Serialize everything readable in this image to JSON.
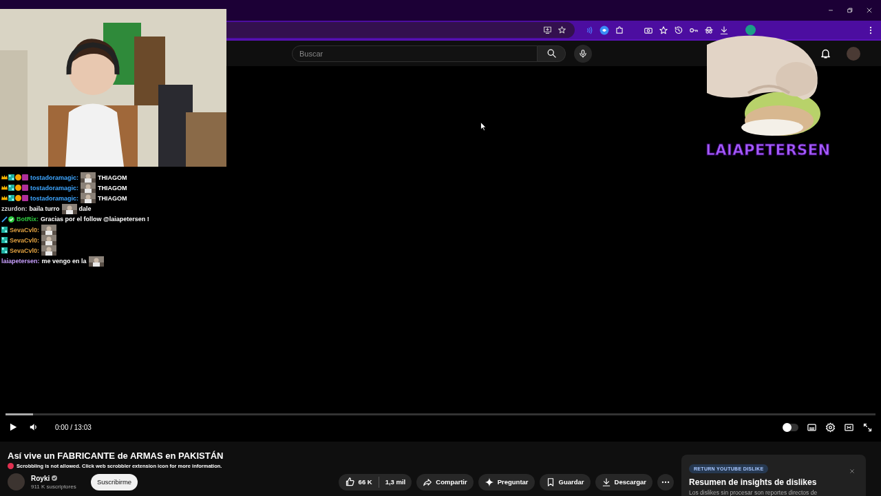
{
  "masthead": {
    "search": {
      "placeholder": "Buscar"
    }
  },
  "player": {
    "progress": {
      "level": 0
    },
    "time": "0:00 / 13:03",
    "autoplay": {
      "on": false
    }
  },
  "video": {
    "title": "Así vive un FABRICANTE de ARMAS en PAKISTÁN",
    "scrobble_note": "Scrobbling is not allowed. Click web scrobbler extension icon for more information.",
    "channel": {
      "name": "Royki",
      "verified": true,
      "subscribers": "911 K suscriptores"
    },
    "subscribe": "Suscribirme",
    "likes": "66 K",
    "dislikes": "1,3 mil",
    "actions": [
      {
        "kind": "share",
        "label": "Compartir"
      },
      {
        "kind": "ask",
        "label": "Preguntar"
      },
      {
        "kind": "save",
        "label": "Guardar"
      },
      {
        "kind": "download",
        "label": "Descargar"
      }
    ]
  },
  "dislike_card": {
    "badge": "RETURN YOUTUBE DISLIKE",
    "title": "Resumen de insights de dislikes",
    "text": "Los dislikes sin procesar son reportes directos de"
  },
  "overlay": {
    "streamer_name": "LAIAPETERSEN",
    "chat": [
      {
        "badges": [
          {
            "kind": "crown"
          },
          {
            "kind": "grid"
          },
          {
            "kind": "coin"
          },
          {
            "kind": "sub"
          }
        ],
        "user": "tostadoramagic:",
        "color": "#3ea6ff",
        "parts": [
          {
            "kind": "emote"
          },
          {
            "kind": "text",
            "text": "THIAGOM"
          }
        ]
      },
      {
        "badges": [
          {
            "kind": "crown"
          },
          {
            "kind": "grid"
          },
          {
            "kind": "coin"
          },
          {
            "kind": "sub"
          }
        ],
        "user": "tostadoramagic:",
        "color": "#3ea6ff",
        "parts": [
          {
            "kind": "emote"
          },
          {
            "kind": "text",
            "text": "THIAGOM"
          }
        ]
      },
      {
        "badges": [
          {
            "kind": "crown"
          },
          {
            "kind": "grid"
          },
          {
            "kind": "coin"
          },
          {
            "kind": "sub"
          }
        ],
        "user": "tostadoramagic:",
        "color": "#3ea6ff",
        "parts": [
          {
            "kind": "emote"
          },
          {
            "kind": "text",
            "text": "THIAGOM"
          }
        ]
      },
      {
        "user": "zzurdon:",
        "color": "#d6d6d6",
        "parts": [
          {
            "kind": "text",
            "text": "baila turro"
          },
          {
            "kind": "emote"
          },
          {
            "kind": "text",
            "text": "dale"
          }
        ]
      },
      {
        "badges": [
          {
            "kind": "sword"
          },
          {
            "kind": "check"
          }
        ],
        "user": "BotRix:",
        "color": "#2ecc40",
        "parts": [
          {
            "kind": "text",
            "text": "Gracias por el follow @laiapetersen !"
          }
        ]
      },
      {
        "badges": [
          {
            "kind": "grid"
          }
        ],
        "user": "SevaCvl0:",
        "color": "#e0a040",
        "parts": [
          {
            "kind": "emote"
          }
        ]
      },
      {
        "badges": [
          {
            "kind": "grid"
          }
        ],
        "user": "SevaCvl0:",
        "color": "#e0a040",
        "parts": [
          {
            "kind": "emote"
          }
        ]
      },
      {
        "badges": [
          {
            "kind": "grid"
          }
        ],
        "user": "SevaCvl0:",
        "color": "#e0a040",
        "parts": [
          {
            "kind": "emote"
          }
        ]
      },
      {
        "user": "laiapetersen:",
        "color": "#c9a0ff",
        "parts": [
          {
            "kind": "text",
            "text": "me vengo en la"
          },
          {
            "kind": "emote"
          }
        ]
      }
    ]
  }
}
